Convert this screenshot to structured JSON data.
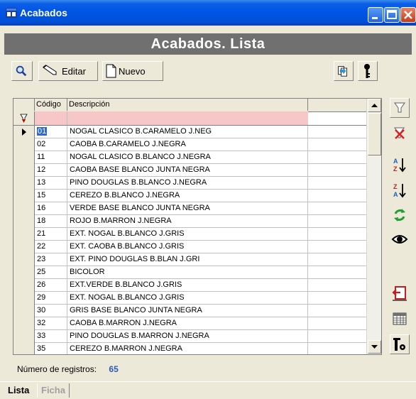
{
  "window": {
    "title": "Acabados"
  },
  "header": {
    "title": "Acabados. Lista"
  },
  "toolbar": {
    "edit_label": "Editar",
    "new_label": "Nuevo"
  },
  "grid": {
    "columns": [
      "Código",
      "Descripción"
    ],
    "rows": [
      {
        "code": "01",
        "desc": "NOGAL CLASICO B.CARAMELO J.NEG"
      },
      {
        "code": "02",
        "desc": "CAOBA B.CARAMELO J.NEGRA"
      },
      {
        "code": "11",
        "desc": "NOGAL CLASICO B.BLANCO J.NEGRA"
      },
      {
        "code": "12",
        "desc": "CAOBA BASE BLANCO JUNTA NEGRA"
      },
      {
        "code": "13",
        "desc": "PINO DOUGLAS B.BLANCO J.NEGRA"
      },
      {
        "code": "15",
        "desc": "CEREZO B.BLANCO J.NEGRA"
      },
      {
        "code": "16",
        "desc": "VERDE BASE BLANCO JUNTA NEGRA"
      },
      {
        "code": "18",
        "desc": "ROJO B.MARRON J.NEGRA"
      },
      {
        "code": "21",
        "desc": "EXT. NOGAL  B.BLANCO J.GRIS"
      },
      {
        "code": "22",
        "desc": "EXT. CAOBA  B.BLANCO J.GRIS"
      },
      {
        "code": "23",
        "desc": "EXT. PINO DOUGLAS B.BLAN J.GRI"
      },
      {
        "code": "25",
        "desc": "BICOLOR"
      },
      {
        "code": "26",
        "desc": "EXT.VERDE B.BLANCO J.GRIS"
      },
      {
        "code": "29",
        "desc": "EXT. NOGAL B.BLANCO J.GRIS"
      },
      {
        "code": "30",
        "desc": "GRIS BASE BLANCO JUNTA NEGRA"
      },
      {
        "code": "32",
        "desc": "CAOBA B.MARRON J.NEGRA"
      },
      {
        "code": "33",
        "desc": "PINO DOUGLAS B.MARRON J.NEGRA"
      },
      {
        "code": "35",
        "desc": "CEREZO B.MARRON J.NEGRA"
      }
    ]
  },
  "status": {
    "label": "Número de registros:",
    "count": "65"
  },
  "tabs": {
    "active": "Lista",
    "inactive": "Ficha"
  }
}
